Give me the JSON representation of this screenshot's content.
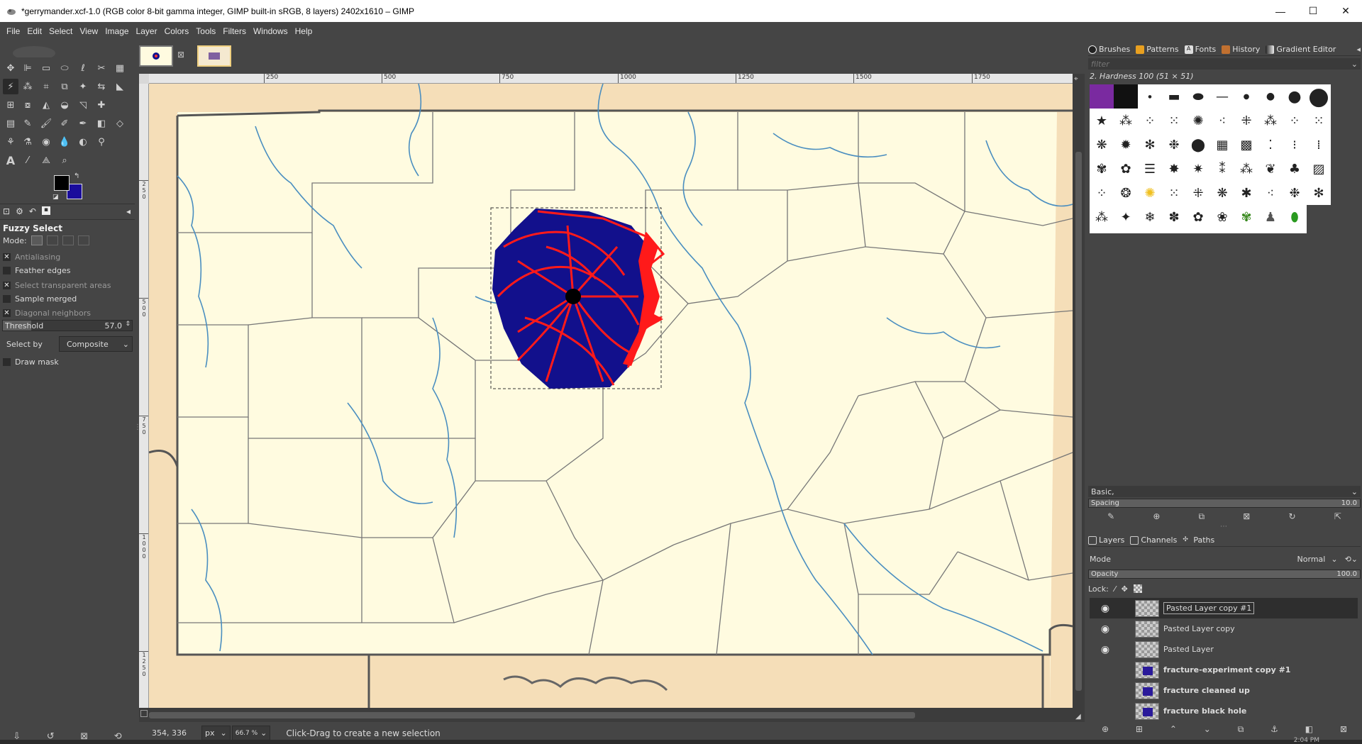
{
  "window": {
    "title": "*gerrymander.xcf-1.0 (RGB color 8-bit gamma integer, GIMP built-in sRGB, 8 layers) 2402x1610 – GIMP",
    "minimize": "—",
    "maximize": "☐",
    "close": "✕"
  },
  "menu": [
    "File",
    "Edit",
    "Select",
    "View",
    "Image",
    "Layer",
    "Colors",
    "Tools",
    "Filters",
    "Windows",
    "Help"
  ],
  "tool_options": {
    "title": "Fuzzy Select",
    "mode_label": "Mode:",
    "antialiasing": "Antialiasing",
    "feather_edges": "Feather edges",
    "select_transparent": "Select transparent areas",
    "sample_merged": "Sample merged",
    "diagonal_neighbors": "Diagonal neighbors",
    "threshold_label": "Threshold",
    "threshold_value": "57.0",
    "threshold_level": 0.22,
    "select_by_label": "Select by",
    "select_by_value": "Composite",
    "draw_mask": "Draw mask",
    "checked": {
      "antialiasing": true,
      "feather_edges": false,
      "select_transparent": true,
      "sample_merged": false,
      "diagonal_neighbors": true,
      "draw_mask": false
    }
  },
  "colors": {
    "foreground": "#000000",
    "background": "#1a0c9c",
    "accent_blue": "#12108c",
    "accent_red": "#ff1a1a",
    "map_bg": "#fffbe0",
    "map_edge": "#f5deb8",
    "water": "#4a8ec0"
  },
  "ruler": {
    "h_ticks": [
      "250",
      "500",
      "750",
      "1000",
      "1250",
      "1500",
      "1750"
    ],
    "v_ticks": [
      "2\n5\n0",
      "5\n0\n0",
      "7\n5\n0",
      "1\n0\n0\n0",
      "1\n2\n5\n0",
      "1\n5\n0\n0"
    ]
  },
  "status": {
    "coords": "354, 336",
    "unit": "px",
    "zoom": "66.7 %",
    "message": "Click-Drag to create a new selection"
  },
  "brushes": {
    "tabs": [
      "Brushes",
      "Patterns",
      "Fonts",
      "History",
      "Gradient Editor"
    ],
    "filter_placeholder": "filter",
    "current": "2. Hardness 100 (51 × 51)",
    "preset": "Basic,",
    "spacing_label": "Spacing",
    "spacing_value": "10.0",
    "spacing_level": 1.0
  },
  "layers": {
    "tabs": [
      "Layers",
      "Channels",
      "Paths"
    ],
    "mode_label": "Mode",
    "mode_value": "Normal",
    "opacity_label": "Opacity",
    "opacity_value": "100.0",
    "opacity_level": 1.0,
    "lock_label": "Lock:",
    "items": [
      {
        "name": "Pasted Layer copy #1",
        "visible": true,
        "bold": false,
        "selected": true
      },
      {
        "name": "Pasted Layer copy",
        "visible": true,
        "bold": false,
        "selected": false
      },
      {
        "name": "Pasted Layer",
        "visible": true,
        "bold": false,
        "selected": false
      },
      {
        "name": "fracture-experiment copy #1",
        "visible": false,
        "bold": true,
        "selected": false
      },
      {
        "name": "fracture cleaned up",
        "visible": false,
        "bold": true,
        "selected": false
      },
      {
        "name": "fracture black hole",
        "visible": false,
        "bold": true,
        "selected": false
      }
    ]
  },
  "taskbar": {
    "clock": "2:04 PM"
  }
}
